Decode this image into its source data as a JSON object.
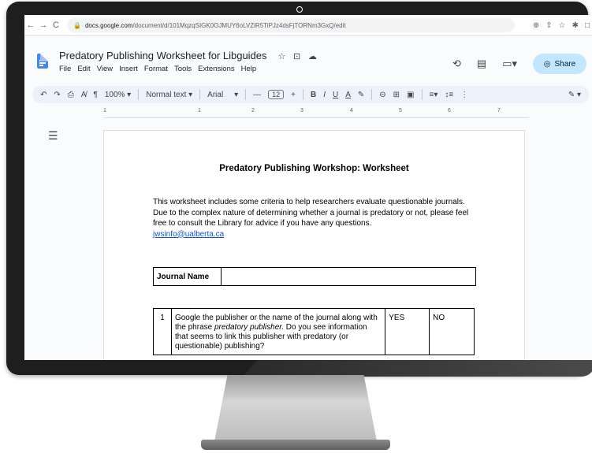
{
  "browser": {
    "url_host": "docs.google.com",
    "url_path": "/document/d/101MqzqSIGK0OJMUY6oLVZiR5TiPJz4dsFjTORNm3GxQ/edit"
  },
  "docs": {
    "title": "Predatory Publishing Worksheet for Libguides",
    "menu": [
      "File",
      "Edit",
      "View",
      "Insert",
      "Format",
      "Tools",
      "Extensions",
      "Help"
    ],
    "share_label": "Share"
  },
  "toolbar": {
    "zoom": "100%",
    "style": "Normal text",
    "font": "Arial",
    "font_size": "12"
  },
  "ruler": [
    "1",
    "1",
    "2",
    "3",
    "4",
    "5",
    "6",
    "7"
  ],
  "document": {
    "heading": "Predatory Publishing Workshop: Worksheet",
    "intro": "This worksheet includes some criteria to help researchers evaluate questionable journals. Due to the complex nature of determining whether a journal is predatory or not, please feel free to consult the Library for advice if you have any questions.",
    "email": "jwsinfo@ualberta.ca",
    "journal_name_label": "Journal Name",
    "q1_number": "1",
    "q1_text_before": "Google the publisher or the name of the journal along with the phrase ",
    "q1_text_em": "predatory publisher.",
    "q1_text_after": " Do you see information that seems to link this publisher with predatory (or questionable) publishing?",
    "yes_label": "YES",
    "no_label": "NO"
  }
}
